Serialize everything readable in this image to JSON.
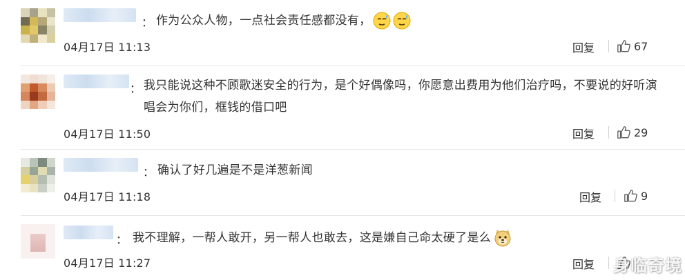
{
  "comments": [
    {
      "text": "作为公众人物，一点社会责任感都没有，",
      "emojis": [
        "sweat-smile-emoji",
        "sweat-smile-emoji"
      ],
      "time": "04月17日 11:13",
      "reply": "回复",
      "likes": "67"
    },
    {
      "text": "我只能说这种不顾歌迷安全的行为，是个好偶像吗，你愿意出费用为他们治疗吗，不要说的好听演唱会为你们，框钱的借口吧",
      "time": "04月17日 11:50",
      "reply": "回复",
      "likes": "29"
    },
    {
      "text": "确认了好几遍是不是洋葱新闻",
      "time": "04月17日 11:18",
      "reply": "回复",
      "likes": "9"
    },
    {
      "text": "我不理解，一帮人敢开，另一帮人也敢去，这是嫌自己命太硬了是么",
      "emojis": [
        "doge-emoji"
      ],
      "time": "04月17日 11:27",
      "reply": "回复",
      "likes": ""
    }
  ],
  "colon": "：",
  "watermark": "身临奇境"
}
